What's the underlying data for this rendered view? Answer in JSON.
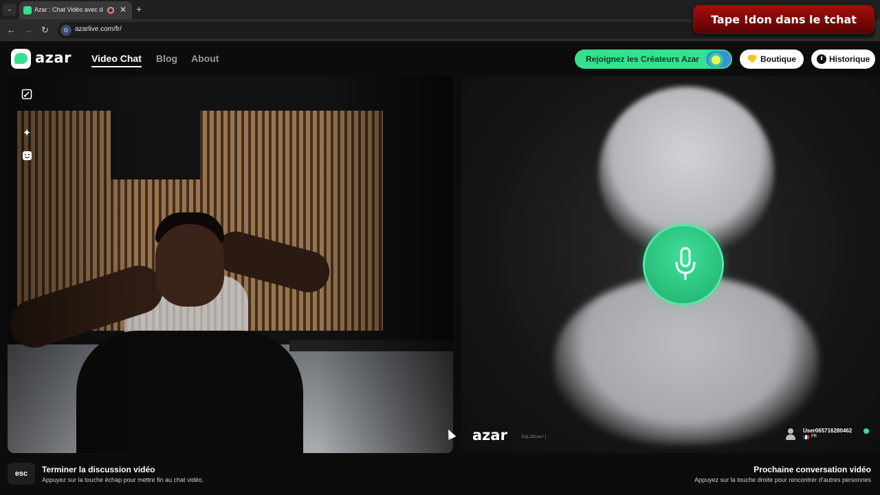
{
  "browser": {
    "tab_title": "Azar : Chat Vidéo avec de n",
    "url": "azarlive.com/fr/",
    "new_tab_symbol": "+",
    "close_symbol": "✕",
    "icons": [
      "tab-list-icon",
      "favicon-icon",
      "recording-icon",
      "back-icon",
      "forward-icon",
      "reload-icon",
      "site-info-icon"
    ]
  },
  "overlay": {
    "text": "Tape !don dans le tchat"
  },
  "header": {
    "logo_text": "azar",
    "nav": [
      {
        "label": "Video Chat",
        "active": true
      },
      {
        "label": "Blog",
        "active": false
      },
      {
        "label": "About",
        "active": false
      }
    ],
    "creators_label": "Rejoignez les Créateurs Azar",
    "shop_label": "Boutique",
    "history_label": "Historique"
  },
  "local_video": {
    "tools": [
      "minimize-icon",
      "sparkle-effects-icon",
      "emoji-icon"
    ]
  },
  "remote": {
    "logo_text": "azar",
    "id_text": "EqLzDCeerj",
    "user_name": "User065716280462",
    "country": "FR",
    "status_color": "#35e08f"
  },
  "footer": {
    "esc_label": "esc",
    "end_title": "Terminer la discussion vidéo",
    "end_sub": "Appuyez sur la touche échap pour mettre fin au chat vidéo.",
    "next_title": "Prochaine conversation vidéo",
    "next_sub": "Appuyez sur la touche droite pour rencontrer d'autres personnes"
  },
  "colors": {
    "accent": "#35e08f",
    "banner": "#a50d0d",
    "background": "#0c0c0c"
  }
}
